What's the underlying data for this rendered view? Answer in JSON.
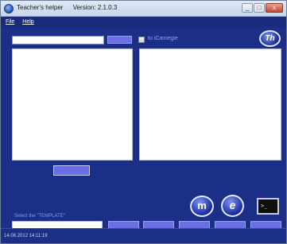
{
  "window": {
    "title": "Teacher's helper",
    "version": "Version: 2.1.0.3",
    "minimize_glyph": "_",
    "maximize_glyph": "□",
    "close_glyph": "x"
  },
  "menu": {
    "items": [
      {
        "label": "File"
      },
      {
        "label": "Help"
      }
    ]
  },
  "main": {
    "search_value": "",
    "checkbox_label": "to iCarnegie",
    "checkbox_checked": false,
    "logo_top_text": "Th",
    "logo_m_text": "m",
    "logo_e_text": "e",
    "terminal_text": ">_",
    "template_label": "Select the \"TEMPLATE\"",
    "template_value": ""
  },
  "status": {
    "datetime": "14.08.2012 14:11:19"
  },
  "colors": {
    "background": "#1c2f86",
    "button": "#6a6fe6",
    "label": "#8fa3ff"
  }
}
